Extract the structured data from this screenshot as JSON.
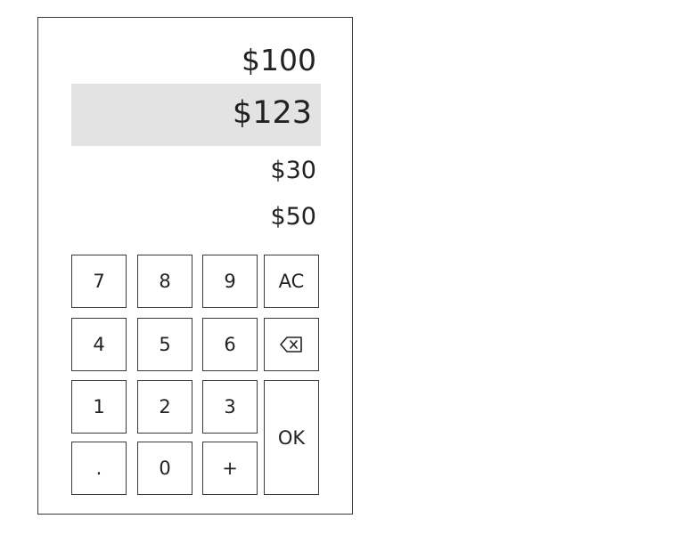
{
  "amounts": {
    "top": "$100",
    "selected": "$123",
    "third": "$30",
    "fourth": "$50"
  },
  "keypad": {
    "k7": "7",
    "k8": "8",
    "k9": "9",
    "clear": "AC",
    "k4": "4",
    "k5": "5",
    "k6": "6",
    "backspace_icon": "backspace-icon",
    "k1": "1",
    "k2": "2",
    "k3": "3",
    "ok": "OK",
    "decimal": ".",
    "k0": "0",
    "plus": "+"
  }
}
